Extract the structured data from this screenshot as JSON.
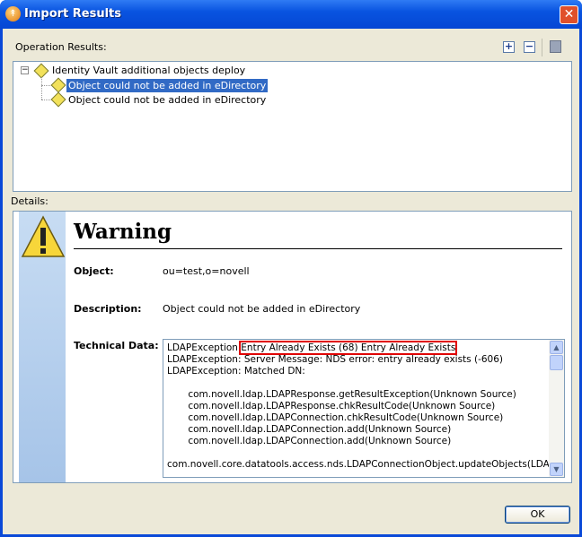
{
  "window": {
    "title": "Import Results"
  },
  "operation_results": {
    "label": "Operation Results:",
    "expand_all": "expand-all",
    "collapse_all": "collapse-all",
    "save": "save",
    "tree": {
      "root": "Identity Vault additional objects deploy",
      "children": [
        "Object could not be added in eDirectory",
        "Object could not be added in eDirectory"
      ]
    }
  },
  "details": {
    "label": "Details:",
    "heading": "Warning",
    "object_label": "Object:",
    "object_value": "ou=test,o=novell",
    "description_label": "Description:",
    "description_value": "Object could not be added in eDirectory",
    "technical_label": "Technical Data:",
    "technical_prefix": "LDAPException",
    "technical_highlight": "Entry Already Exists (68) Entry Already Exists",
    "technical_rest": "LDAPException: Server Message: NDS error: entry already exists (-606)\nLDAPException: Matched DN:\n\n       com.novell.ldap.LDAPResponse.getResultException(Unknown Source)\n       com.novell.ldap.LDAPResponse.chkResultCode(Unknown Source)\n       com.novell.ldap.LDAPConnection.chkResultCode(Unknown Source)\n       com.novell.ldap.LDAPConnection.add(Unknown Source)\n       com.novell.ldap.LDAPConnection.add(Unknown Source)\n\ncom.novell.core.datatools.access.nds.LDAPConnectionObject.updateObjects(LDAPCon"
  },
  "buttons": {
    "ok": "OK"
  }
}
